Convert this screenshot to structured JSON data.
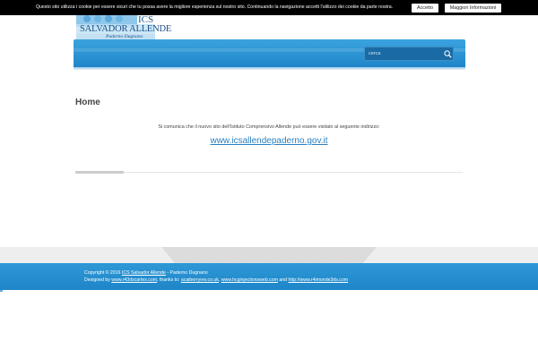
{
  "cookie": {
    "message": "Questo sito utilizza i cookie per essere sicuri che tu possa avere la migliore esperienza sul nostro sito. Continuando la navigazione accetti l'utilizzo dei cookie da parte nostra.",
    "accept_label": "Accetto",
    "more_label": "Maggiori Informazioni"
  },
  "logo": {
    "acronym": "ICS",
    "name": "SALVADOR ALLENDE",
    "location": "Paderno Dugnano"
  },
  "search": {
    "placeholder": "cerca"
  },
  "main": {
    "title": "Home",
    "notice": "Si comunica che il nuovo sito dell'Istituto Comprensivo Allende può essere visitato al seguente indirizzo:",
    "link": "www.icsallendepaderno.gov.it"
  },
  "footer": {
    "copyright_prefix": "Copyright © 2016",
    "copyright_link": "ICS Salvador Allende",
    "copyright_suffix": " - Paderno Dugnano",
    "designed_prefix": "Designed by",
    "designer_link": "www.r43dscartex.com",
    "thanks_text": ", thanks to: ",
    "thanks_link1": "acaiberryrev.co.uk",
    "thanks_link2": "www.hcginjectionsweb.com",
    "and_text": " and ",
    "thanks_link3": "http://www.r4imonde3ds.com"
  },
  "colors": {
    "accent": "#2a8fd1",
    "cookie_bar": "#000000",
    "link": "#2a7fc0"
  }
}
